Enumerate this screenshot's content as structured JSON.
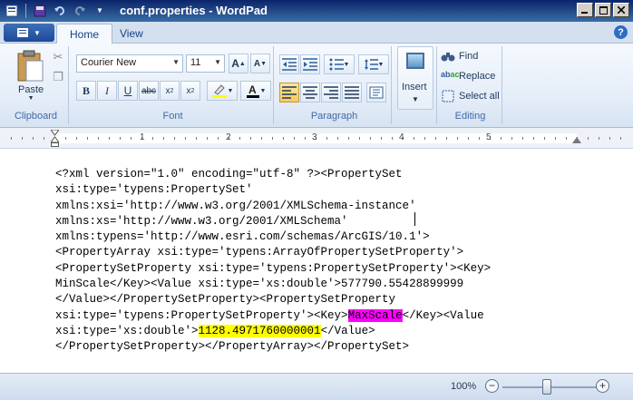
{
  "window": {
    "title": "conf.properties - WordPad"
  },
  "tabs": [
    {
      "label": "Home",
      "active": true
    },
    {
      "label": "View",
      "active": false
    }
  ],
  "clipboard": {
    "paste_label": "Paste",
    "group_label": "Clipboard"
  },
  "font": {
    "family": "Courier New",
    "size": "11",
    "group_label": "Font"
  },
  "paragraph": {
    "group_label": "Paragraph"
  },
  "insert": {
    "label": "Insert"
  },
  "editing": {
    "find": "Find",
    "replace": "Replace",
    "select_all": "Select all",
    "group_label": "Editing"
  },
  "ruler": {
    "numbers": [
      "1",
      "2",
      "3",
      "4",
      "5"
    ]
  },
  "document": {
    "lines": [
      "<?xml version=\"1.0\" encoding=\"utf-8\" ?><PropertySet",
      "xsi:type='typens:PropertySet'",
      "xmlns:xsi='http://www.w3.org/2001/XMLSchema-instance'",
      "xmlns:xs='http://www.w3.org/2001/XMLSchema'",
      "xmlns:typens='http://www.esri.com/schemas/ArcGIS/10.1'>",
      "<PropertyArray xsi:type='typens:ArrayOfPropertySetProperty'>",
      "<PropertySetProperty xsi:type='typens:PropertySetProperty'><Key>",
      "MinScale</Key><Value xsi:type='xs:double'>577790.55428899999",
      "</Value></PropertySetProperty><PropertySetProperty",
      "xsi:type='typens:PropertySetProperty'><Key>",
      "MaxScale",
      "</Key><Value",
      "xsi:type='xs:double'>",
      "1128.4971760000001",
      "</Value>",
      "</PropertySetProperty></PropertyArray></PropertySet>"
    ]
  },
  "status": {
    "zoom": "100%",
    "zoom_out": "−",
    "zoom_in": "+"
  },
  "highlight_colors": {
    "magenta": "#ff00ff",
    "yellow": "#ffff00"
  }
}
